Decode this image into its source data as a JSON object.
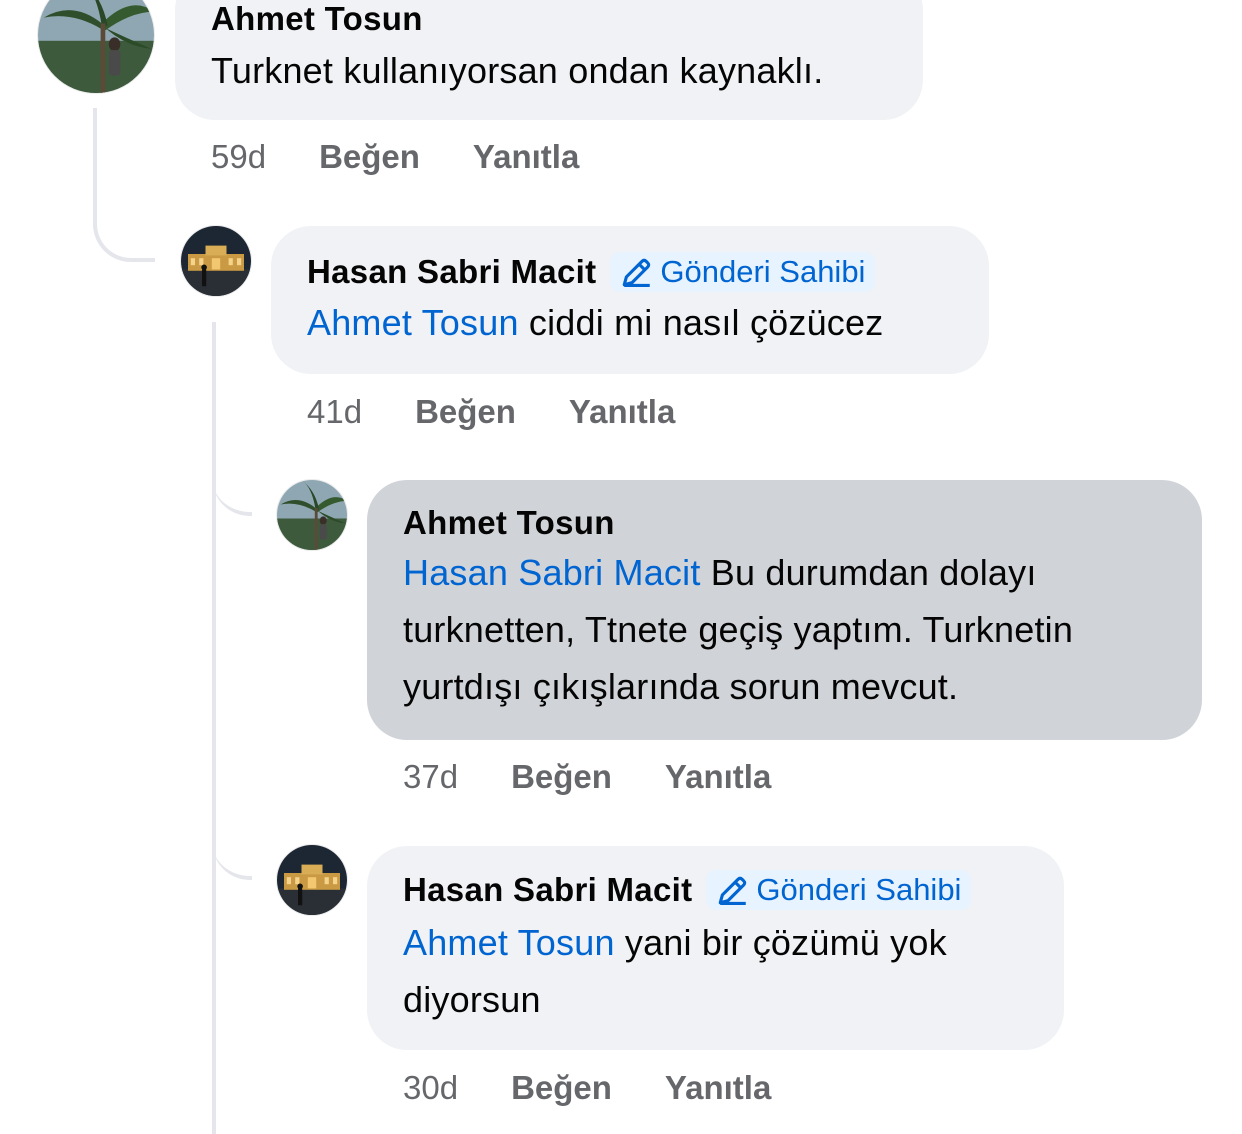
{
  "comments": [
    {
      "author": "Ahmet Tosun",
      "mention": "",
      "text": "Turknet kullanıyorsan ondan kaynaklı.",
      "time": "59d",
      "like": "Beğen",
      "reply": "Yanıtla"
    },
    {
      "author": "Hasan Sabri Macit",
      "badge": "Gönderi Sahibi",
      "mention": "Ahmet Tosun",
      "text": "ciddi mi nasıl çözücez",
      "time": "41d",
      "like": "Beğen",
      "reply": "Yanıtla"
    },
    {
      "author": "Ahmet Tosun",
      "mention": "Hasan Sabri Macit",
      "lines": [
        "Bu durumdan dolayı",
        "turknetten, Ttnete geçiş yaptım. Turknetin",
        "yurtdışı çıkışlarında sorun mevcut."
      ],
      "time": "37d",
      "like": "Beğen",
      "reply": "Yanıtla"
    },
    {
      "author": "Hasan Sabri Macit",
      "badge": "Gönderi Sahibi",
      "mention": "Ahmet Tosun",
      "lines": [
        "yani bir çözümü yok",
        "diyorsun"
      ],
      "time": "30d",
      "like": "Beğen",
      "reply": "Yanıtla"
    }
  ],
  "icons": {
    "badge_icon": "pencil-icon",
    "avatar_ahmet": "palm-tree-photo",
    "avatar_hasan": "night-building-photo"
  },
  "colors": {
    "bubble": "#f0f2f5",
    "highlight_bubble": "#d0d3d8",
    "mention": "#0064d1",
    "badge_bg": "#e7f3ff",
    "meta": "#65676b",
    "thread_line": "#e4e6eb"
  }
}
